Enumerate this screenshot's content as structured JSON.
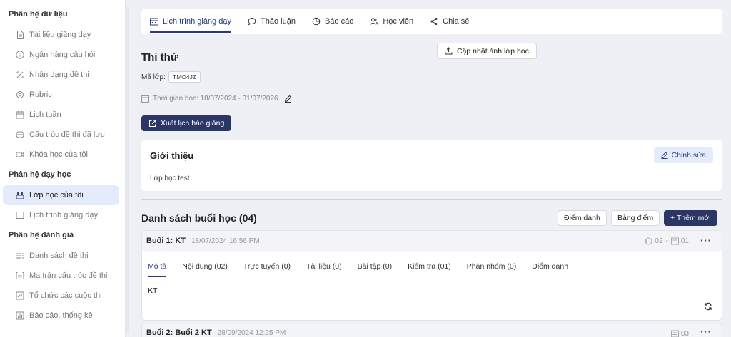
{
  "sidebar": {
    "sections": [
      {
        "title": "Phân hệ dữ liệu",
        "items": [
          {
            "label": "Tài liệu giảng dạy",
            "icon": "document-icon"
          },
          {
            "label": "Ngân hàng câu hỏi",
            "icon": "question-icon"
          },
          {
            "label": "Nhận dạng đề thi",
            "icon": "scan-icon"
          },
          {
            "label": "Rubric",
            "icon": "rubric-icon"
          },
          {
            "label": "Lịch tuần",
            "icon": "calendar-icon"
          },
          {
            "label": "Cấu trúc đề thi đã lưu",
            "icon": "archive-icon"
          },
          {
            "label": "Khóa học của tôi",
            "icon": "video-icon"
          }
        ]
      },
      {
        "title": "Phân hệ dạy học",
        "items": [
          {
            "label": "Lớp học của tôi",
            "icon": "classroom-icon",
            "active": true
          },
          {
            "label": "Lịch trình giảng dạy",
            "icon": "schedule-icon"
          }
        ]
      },
      {
        "title": "Phân hệ đánh giá",
        "items": [
          {
            "label": "Danh sách đề thi",
            "icon": "list-icon"
          },
          {
            "label": "Ma trận cấu trúc đề thi",
            "icon": "matrix-icon"
          },
          {
            "label": "Tổ chức các cuộc thi",
            "icon": "exam-icon"
          },
          {
            "label": "Báo cáo, thống kê",
            "icon": "report-icon"
          }
        ]
      }
    ]
  },
  "tabs": [
    {
      "label": "Lịch trình giảng dạy",
      "icon": "schedule-icon",
      "active": true
    },
    {
      "label": "Thảo luận",
      "icon": "chat-icon"
    },
    {
      "label": "Báo cáo",
      "icon": "pie-chart-icon"
    },
    {
      "label": "Học viên",
      "icon": "users-icon"
    },
    {
      "label": "Chia sẻ",
      "icon": "share-icon"
    }
  ],
  "header": {
    "update_photo_label": "Cập nhật ảnh lớp học",
    "class_title": "Thi thử",
    "class_code_label": "Mã lớp:",
    "class_code": "TMO4JZ",
    "time_label": "Thời gian học: 18/07/2024 - 31/07/2026",
    "export_label": "Xuất lịch báo giảng"
  },
  "intro": {
    "title": "Giới thiệu",
    "edit_label": "Chỉnh sửa",
    "text": "Lớp học test"
  },
  "sessions": {
    "title": "Danh sách buổi học (04)",
    "attendance_label": "Điểm danh",
    "gradebook_label": "Bảng điểm",
    "add_label": "+ Thêm mới",
    "items": [
      {
        "name": "Buổi 1: KT",
        "date": "18/07/2024 16:56 PM",
        "meta_a": "02",
        "meta_sep": "-",
        "meta_b": "01",
        "subtabs": [
          "Mô tả",
          "Nội dung (02)",
          "Trực tuyến (0)",
          "Tài liệu (0)",
          "Bài tập (0)",
          "Kiểm tra (01)",
          "Phân nhóm (0)",
          "Điểm danh"
        ],
        "body": "KT"
      },
      {
        "name": "Buổi 2: Buổi 2 KT",
        "date": "28/09/2024 12:25 PM",
        "meta_b": "03"
      }
    ]
  },
  "colors": {
    "primary": "#2b3566",
    "accent": "#2b3a7a",
    "active_bg": "#e4ecfb",
    "page_bg": "#eef0f6"
  }
}
